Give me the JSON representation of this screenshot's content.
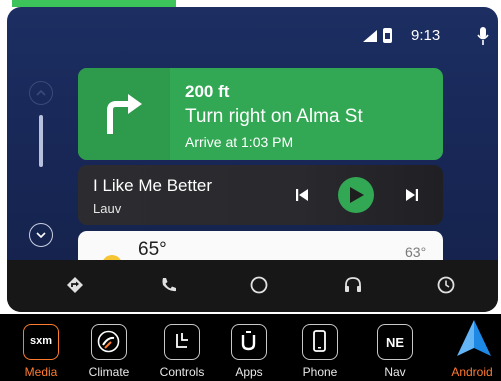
{
  "status": {
    "time": "9:13",
    "icons": [
      "signal-icon",
      "battery-icon",
      "mic-icon"
    ]
  },
  "navigation": {
    "distance": "200 ft",
    "instruction": "Turn right on Alma St",
    "arrival": "Arrive at 1:03 PM",
    "icon": "turn-right-icon",
    "color": "#33a854"
  },
  "media": {
    "title": "I Like Me Better",
    "artist": "Lauv",
    "controls": [
      "previous-icon",
      "play-icon",
      "next-icon"
    ]
  },
  "weather": {
    "current_temp": "65°",
    "low_temp": "63°",
    "icon": "sun-icon"
  },
  "bottom_nav": [
    "navigation-icon",
    "phone-icon",
    "home-icon",
    "headphones-icon",
    "recent-icon"
  ],
  "dock": {
    "items": [
      {
        "label": "Media",
        "tile_text": "sxm",
        "active": true
      },
      {
        "label": "Climate",
        "tile_text": ""
      },
      {
        "label": "Controls",
        "tile_text": ""
      },
      {
        "label": "Apps",
        "tile_text": ""
      },
      {
        "label": "Phone",
        "tile_text": ""
      },
      {
        "label": "Nav",
        "tile_text": "NE"
      },
      {
        "label": "Android",
        "tile_text": "",
        "active": true
      }
    ],
    "active_color": "#ff7b2e"
  }
}
